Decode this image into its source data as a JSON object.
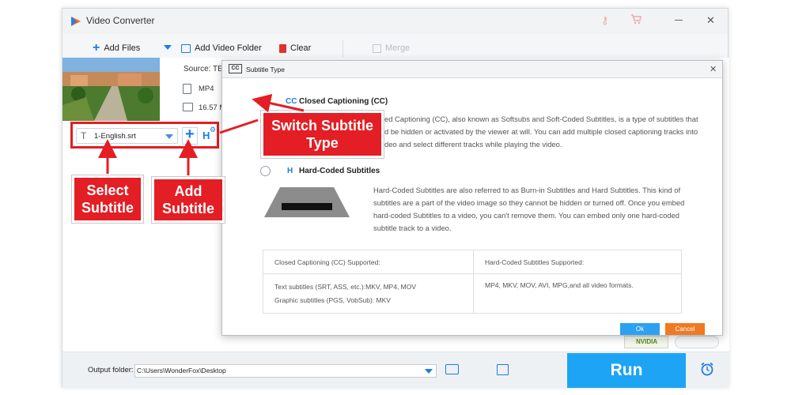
{
  "app": {
    "title": "Video Converter"
  },
  "toolbar": {
    "add_files": "Add Files",
    "add_video_folder": "Add Video Folder",
    "clear": "Clear",
    "merge": "Merge"
  },
  "file_info": {
    "source_label": "Source: TES",
    "format": "MP4",
    "size": "16.57 M"
  },
  "subtitle_bar": {
    "selected": "1-English.srt"
  },
  "dialog": {
    "title": "Subtitle Type",
    "cc": {
      "badge": "CC",
      "label": "Closed Captioning (CC)",
      "desc_line1": "ed Captioning (CC), also known as Softsubs and Soft-Coded Subtitles, is a type of subtitles that",
      "desc_line2": "d be hidden or activated by the viewer at will. You can add multiple closed captioning tracks into",
      "desc_line3": "deo and select different tracks while playing the video."
    },
    "hc": {
      "badge": "H",
      "label": "Hard-Coded Subtitles",
      "desc_line1": "Hard-Coded Subtitles are also referred to as Burn-in Subtitles and Hard Subtitles. This kind of",
      "desc_line2": "subtitles are a part of the video image so they cannot be hidden or turned off.  Once you embed",
      "desc_line3": "hard-coded Subtitles to a video, you can't remove them. You can embed only one hard-coded",
      "desc_line4": "subtitle track to a video."
    },
    "table": {
      "head_cc": "Closed Captioning (CC) Supported:",
      "head_hc": "Hard-Coded Subtitles Supported:",
      "cc_line1": "Text subtitles (SRT, ASS, etc.):MKV, MP4, MOV",
      "cc_line2": "Graphic subtitles (PGS, VobSub): MKV",
      "hc_line1": "MP4, MKV, MOV, AVI, MPG,and all video formats."
    },
    "ok": "Ok",
    "cancel": "Cancel"
  },
  "nvidia": {
    "label": "NVIDIA"
  },
  "bottom": {
    "output_label": "Output folder:",
    "output_path": "C:\\Users\\WonderFox\\Desktop",
    "run": "Run"
  },
  "annotations": {
    "select_subtitle_l1": "Select",
    "select_subtitle_l2": "Subtitle",
    "add_subtitle_l1": "Add",
    "add_subtitle_l2": "Subtitle",
    "switch_l1": "Switch Subtitle",
    "switch_l2": "Type"
  },
  "colors": {
    "accent_blue": "#1e7be3",
    "run_blue": "#1ea4f4",
    "annotation_red": "#e31e24",
    "ok_blue": "#2da1f0",
    "cancel_orange": "#f07a22"
  }
}
